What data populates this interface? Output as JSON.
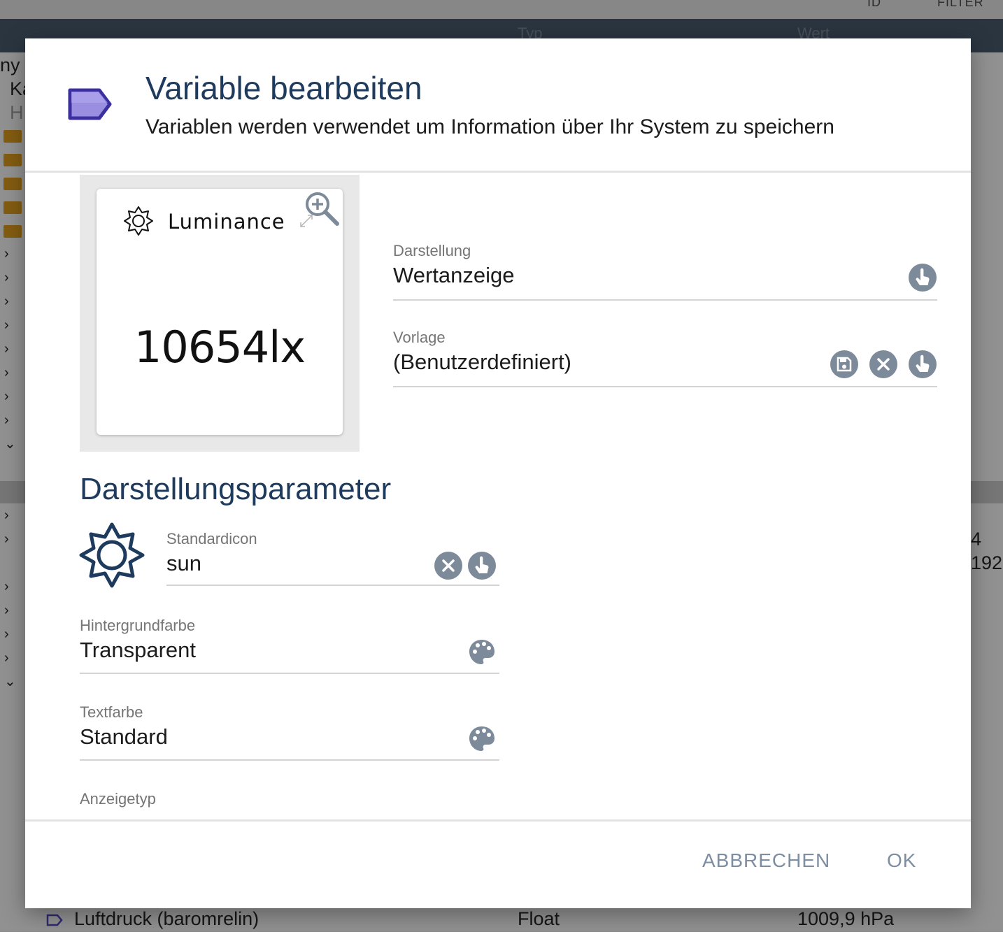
{
  "background": {
    "filter_labels": [
      "ID",
      "FILTER"
    ],
    "column_headers": {
      "type": "Typ",
      "value": "Wert"
    },
    "partial_texts": [
      "ny H",
      "Ka",
      "H"
    ],
    "right_texts": [
      "4",
      "192"
    ],
    "bottom_row": {
      "name": "Luftdruck (baromrelin)",
      "type": "Float",
      "value": "1009,9 hPa"
    }
  },
  "dialog": {
    "title": "Variable bearbeiten",
    "subtitle": "Variablen werden verwendet um Information über Ihr System zu speichern",
    "icon": "tag-icon",
    "accent_color": "#7c6fd1",
    "title_color": "#1e3a5c"
  },
  "preview": {
    "name": "Luminance",
    "value": "10654lx",
    "icon": "sun-icon"
  },
  "fields": {
    "darstellung": {
      "label": "Darstellung",
      "value": "Wertanzeige"
    },
    "vorlage": {
      "label": "Vorlage",
      "value": "(Benutzerdefiniert)"
    },
    "standardicon": {
      "label": "Standardicon",
      "value": "sun"
    },
    "hintergrundfarbe": {
      "label": "Hintergrundfarbe",
      "value": "Transparent"
    },
    "textfarbe": {
      "label": "Textfarbe",
      "value": "Standard"
    },
    "anzeigetyp": {
      "label": "Anzeigetyp",
      "value": ""
    }
  },
  "section": {
    "title": "Darstellungsparameter"
  },
  "footer": {
    "cancel_label": "ABBRECHEN",
    "ok_label": "OK"
  }
}
